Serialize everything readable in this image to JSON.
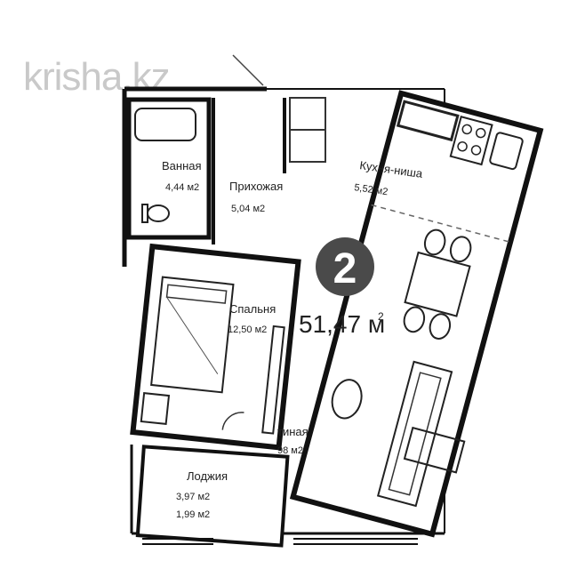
{
  "watermark": "krisha.kz",
  "badge": {
    "number": "2",
    "color": "#4a4a4a"
  },
  "total_area": "51,47 м",
  "total_area_sup": "2",
  "rooms": {
    "bathroom": {
      "name": "Ванная",
      "area": "4,44 м2"
    },
    "hallway": {
      "name": "Прихожая",
      "area": "5,04 м2"
    },
    "kitchen": {
      "name": "Кухня-ниша",
      "area": "5,52 м2"
    },
    "bedroom": {
      "name": "Спальня",
      "area": "12,50 м2"
    },
    "living": {
      "name": "тиная",
      "area": "98 м2"
    },
    "loggia": {
      "name": "Лоджия",
      "area1": "3,97 м2",
      "area2": "1,99 м2"
    }
  }
}
